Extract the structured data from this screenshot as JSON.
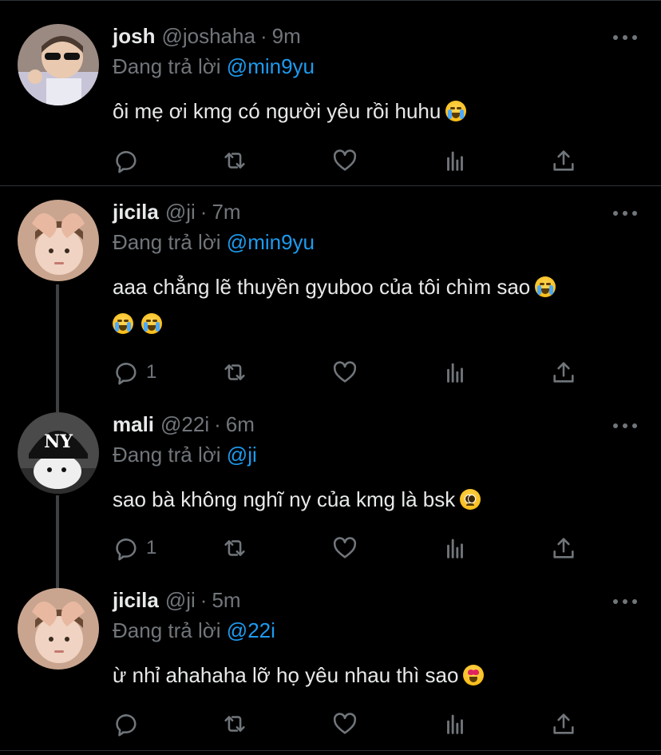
{
  "labels": {
    "replying_prefix": "Đang trả lời",
    "separator": "·"
  },
  "tweets": [
    {
      "name": "josh",
      "handle": "@joshaha",
      "time": "9m",
      "replying_to": "@min9yu",
      "text": "ôi mẹ ơi kmg có người yêu rồi huhu",
      "emoji": [
        "crying-face"
      ],
      "reply_count": ""
    },
    {
      "name": "jicila",
      "handle": "@ji",
      "time": "7m",
      "replying_to": "@min9yu",
      "text": "aaa chẳng lẽ thuyền gyuboo của tôi chìm sao",
      "emoji": [
        "crying-face",
        "crying-face",
        "crying-face"
      ],
      "reply_count": "1"
    },
    {
      "name": "mali",
      "handle": "@22i",
      "time": "6m",
      "replying_to": "@ji",
      "text": "sao bà không nghĩ ny của kmg là bsk",
      "emoji": [
        "pleading-face"
      ],
      "reply_count": "1"
    },
    {
      "name": "jicila",
      "handle": "@ji",
      "time": "5m",
      "replying_to": "@22i",
      "text": "ừ nhỉ ahahaha lỡ họ yêu nhau thì sao",
      "emoji": [
        "heart-eyes-face"
      ],
      "reply_count": ""
    }
  ],
  "colors": {
    "background": "#000000",
    "text": "#e7e9ea",
    "muted": "#71767b",
    "link": "#1d9bf0",
    "divider": "#2f3336"
  }
}
